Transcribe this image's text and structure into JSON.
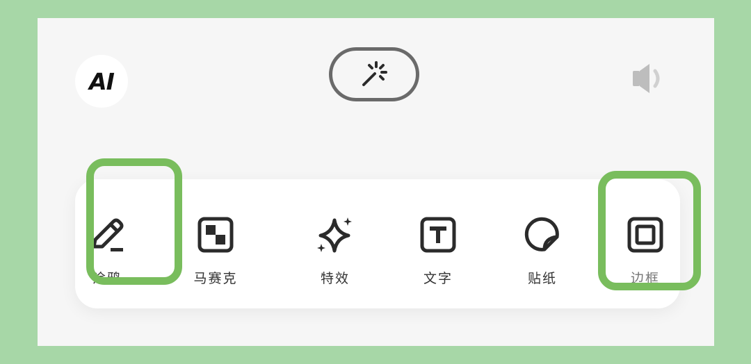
{
  "top_bar": {
    "ai_label": "AI",
    "magic_icon": "magic-wand-icon",
    "speaker_icon": "speaker-icon"
  },
  "tools": [
    {
      "label": "涂鸦",
      "icon": "pencil-icon"
    },
    {
      "label": "马赛克",
      "icon": "mosaic-icon"
    },
    {
      "label": "特效",
      "icon": "sparkle-icon"
    },
    {
      "label": "文字",
      "icon": "text-icon"
    },
    {
      "label": "贴纸",
      "icon": "sticker-icon"
    },
    {
      "label": "边框",
      "icon": "frame-icon"
    }
  ],
  "colors": {
    "background": "#a7d7a7",
    "panel": "#f6f6f6",
    "highlight": "#79bd5d",
    "icon": "#2b2b2b"
  }
}
